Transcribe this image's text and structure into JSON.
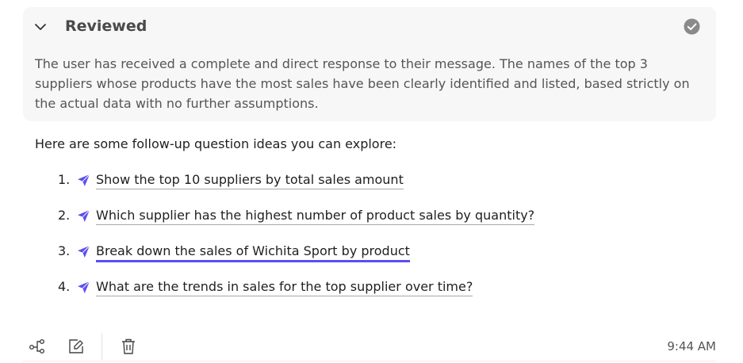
{
  "review": {
    "title": "Reviewed",
    "text": "The user has received a complete and direct response to their message. The names of the top 3 suppliers whose products have the most sales have been clearly identified and listed, based strictly on the actual data with no further assumptions."
  },
  "followups": {
    "intro": "Here are some follow-up question ideas you can explore:",
    "items": [
      {
        "number": "1.",
        "text": "Show the top 10 suppliers by total sales amount"
      },
      {
        "number": "2.",
        "text": "Which supplier has the highest number of product sales by quantity?"
      },
      {
        "number": "3.",
        "text": "Break down the sales of Wichita Sport by product"
      },
      {
        "number": "4.",
        "text": "What are the trends in sales for the top supplier over time?"
      }
    ]
  },
  "footer": {
    "timestamp": "9:44 AM"
  },
  "colors": {
    "accent": "#5b4ff0",
    "panel_bg": "#f7f7f7",
    "check_badge": "#8a8a8a"
  },
  "icons": {
    "collapse": "chevron-down-icon",
    "status": "check-circle-icon",
    "send": "send-icon",
    "lineage": "lineage-icon",
    "edit_share": "edit-link-icon",
    "delete": "trash-icon"
  }
}
